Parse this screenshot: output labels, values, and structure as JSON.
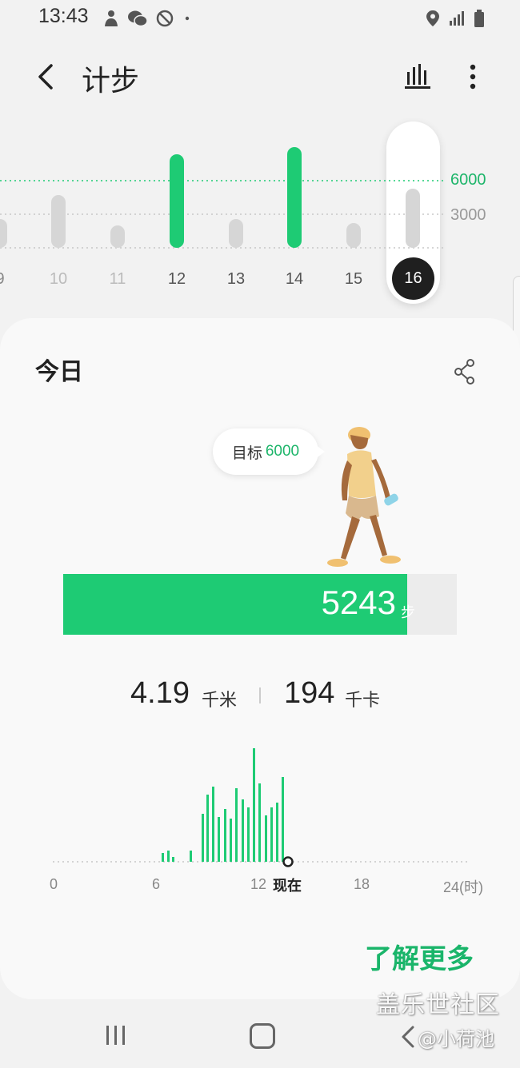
{
  "status_bar": {
    "time": "13:43",
    "left_icons": [
      "notification-person-icon",
      "wechat-icon",
      "do-not-disturb-icon",
      "dot-icon"
    ],
    "right_icons": [
      "location-icon",
      "signal-icon",
      "battery-icon"
    ]
  },
  "header": {
    "title": "计步"
  },
  "weekly": {
    "goal_label": "6000",
    "mid_label": "3000",
    "days": [
      {
        "day": "9",
        "reached_goal": false
      },
      {
        "day": "10",
        "reached_goal": false
      },
      {
        "day": "11",
        "reached_goal": false
      },
      {
        "day": "12",
        "reached_goal": true
      },
      {
        "day": "13",
        "reached_goal": false
      },
      {
        "day": "14",
        "reached_goal": true
      },
      {
        "day": "15",
        "reached_goal": false
      },
      {
        "day": "16",
        "reached_goal": false,
        "selected": true
      }
    ]
  },
  "today": {
    "title": "今日",
    "goal_text": "目标",
    "goal_value": "6000",
    "steps": "5243",
    "steps_unit": "步",
    "progress": 0.874,
    "distance": "4.19",
    "distance_unit": "千米",
    "calories": "194",
    "calories_unit": "千卡",
    "learn_more": "了解更多"
  },
  "hourly": {
    "axis_labels": [
      "0",
      "6",
      "12",
      "18",
      "24(时)"
    ],
    "now_label": "现在"
  },
  "colors": {
    "accent_green": "#1ecb74",
    "text_green": "#1db56a",
    "bar_gray": "#d6d6d6"
  },
  "watermark": {
    "line1": "盖乐世社区",
    "line2": "@小荷池"
  }
}
